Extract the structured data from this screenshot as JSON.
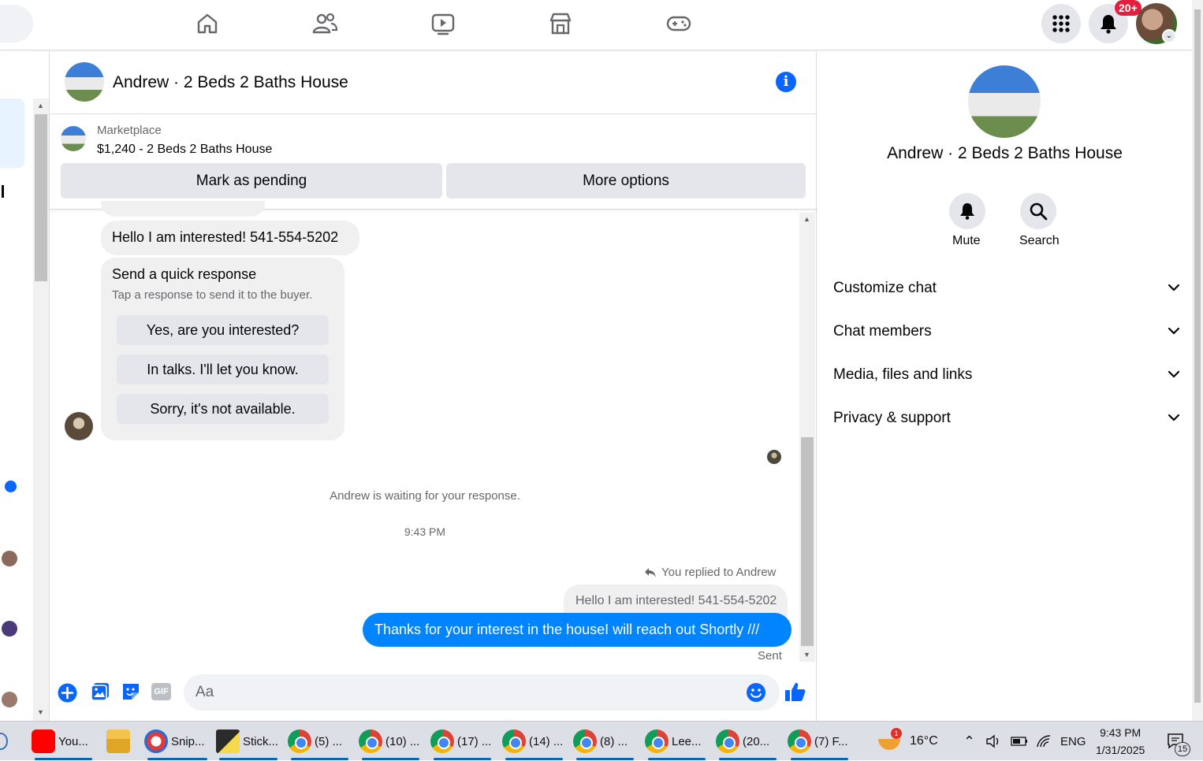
{
  "topbar": {
    "nav_icons": [
      "home-icon",
      "friends-icon",
      "watch-icon",
      "marketplace-icon",
      "gaming-icon"
    ],
    "notification_badge": "20+"
  },
  "chat": {
    "title": "Andrew · 2 Beds 2 Baths House",
    "listing": {
      "source": "Marketplace",
      "price_title": "$1,240 - 2 Beds 2 Baths House",
      "mark_pending": "Mark as pending",
      "more_options": "More options"
    },
    "messages": {
      "incoming_text": "Hello I am interested! 541-554-5202",
      "quick_title": "Send a quick response",
      "quick_subtitle": "Tap a response to send it to the buyer.",
      "quick_options": [
        "Yes, are you interested?",
        "In talks. I'll let you know.",
        "Sorry, it's not available."
      ],
      "waiting_note": "Andrew is waiting for your response.",
      "timestamp": "9:43 PM",
      "replied_note": "You replied to Andrew",
      "quoted_reply": "Hello I am interested! 541-554-5202",
      "outgoing_text": "Thanks for your interest in the houseI will reach out Shortly ///",
      "status": "Sent"
    },
    "composer": {
      "placeholder": "Aa"
    }
  },
  "details": {
    "title": "Andrew · 2 Beds 2 Baths House",
    "actions": [
      "Mute",
      "Search"
    ],
    "sections": [
      "Customize chat",
      "Chat members",
      "Media, files and links",
      "Privacy & support"
    ]
  },
  "taskbar": {
    "items": [
      "You...",
      "",
      "Snip...",
      "Stick...",
      "(5) ...",
      "(10) ...",
      "(17) ...",
      "(14) ...",
      "(8) ...",
      "Lee...",
      "(20...",
      "(7) F..."
    ],
    "weather": "16°C",
    "language": "ENG",
    "time": "9:43 PM",
    "date": "1/31/2025",
    "notif_count": "15",
    "weather_badge": "1"
  },
  "colors": {
    "accent": "#0866ff",
    "bubble_out": "#0084ff",
    "bubble_in": "#f0f0f0",
    "badge": "#e41e3f"
  }
}
